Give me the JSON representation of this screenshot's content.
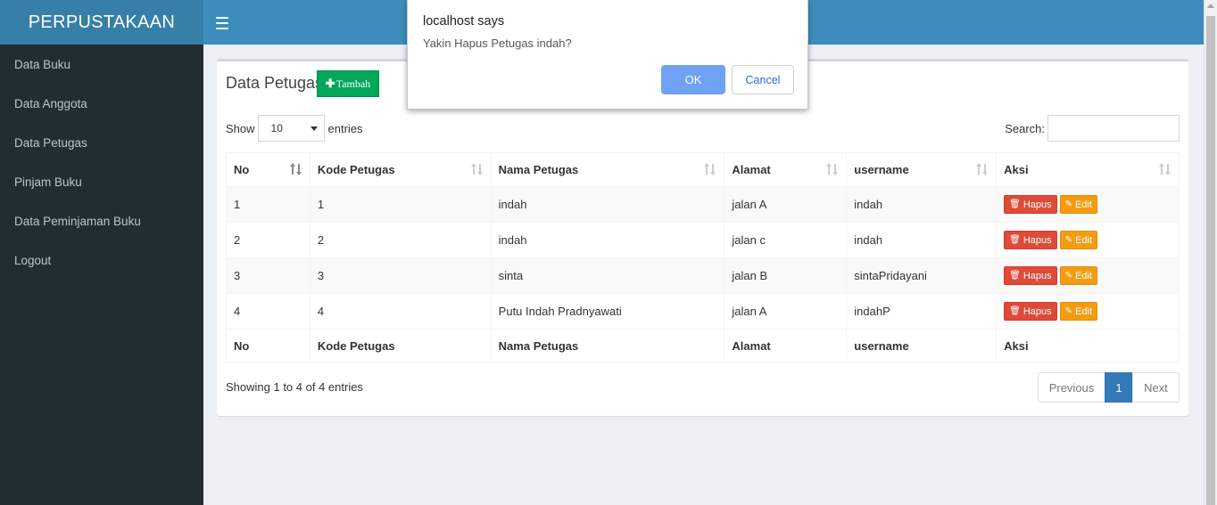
{
  "app": {
    "brand": "PERPUSTAKAAN"
  },
  "sidebar": {
    "items": [
      {
        "label": "Data Buku"
      },
      {
        "label": "Data Anggota"
      },
      {
        "label": "Data Petugas"
      },
      {
        "label": "Pinjam Buku"
      },
      {
        "label": "Data Peminjaman Buku"
      },
      {
        "label": "Logout"
      }
    ]
  },
  "header": {
    "menu_icon": "hamburger-icon"
  },
  "page": {
    "title": "Data Petugas",
    "add_button": "Tambah",
    "show_label": "Show",
    "entries_value": "10",
    "entries_label": "entries",
    "search_label": "Search:",
    "search_value": ""
  },
  "table": {
    "columns": [
      "No",
      "Kode Petugas",
      "Nama Petugas",
      "Alamat",
      "username",
      "Aksi"
    ],
    "rows": [
      {
        "no": "1",
        "kode": "1",
        "nama": "indah",
        "alamat": "jalan A",
        "username": "indah"
      },
      {
        "no": "2",
        "kode": "2",
        "nama": "indah",
        "alamat": "jalan c",
        "username": "indah"
      },
      {
        "no": "3",
        "kode": "3",
        "nama": "sinta",
        "alamat": "jalan B",
        "username": "sintaPridayani"
      },
      {
        "no": "4",
        "kode": "4",
        "nama": "Putu Indah Pradnyawati",
        "alamat": "jalan A",
        "username": "indahP"
      }
    ],
    "delete_label": "Hapus",
    "edit_label": "Edit",
    "info": "Showing 1 to 4 of 4 entries"
  },
  "pagination": {
    "previous": "Previous",
    "current": "1",
    "next": "Next"
  },
  "dialog": {
    "title": "localhost says",
    "message": "Yakin Hapus Petugas indah?",
    "ok": "OK",
    "cancel": "Cancel"
  },
  "colors": {
    "header": "#3c8dbc",
    "logo": "#367fa9",
    "sidebar": "#222d32",
    "success": "#00a65a",
    "danger": "#dd4b39",
    "warning": "#f39c12",
    "primary": "#337ab7"
  }
}
